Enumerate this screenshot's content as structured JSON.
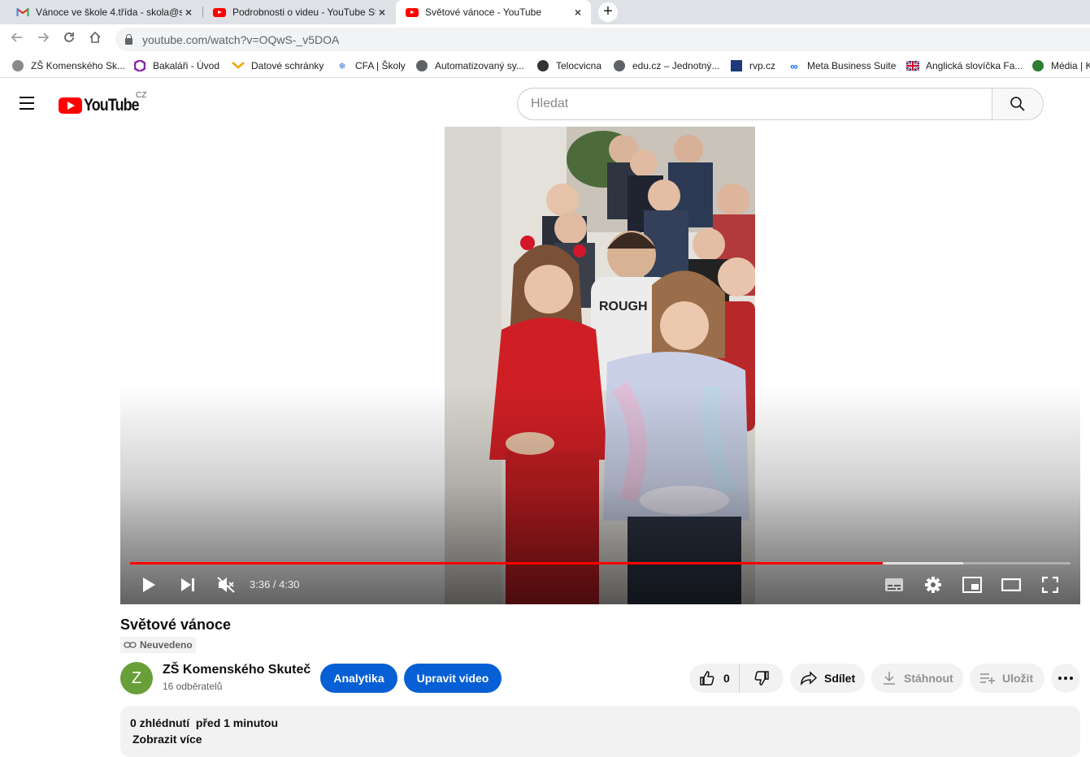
{
  "browser": {
    "tabs": [
      {
        "title": "Vánoce ve škole 4.třída - skola@s",
        "favicon": "gmail-icon"
      },
      {
        "title": "Podrobnosti o videu - YouTube St",
        "favicon": "youtube-icon"
      },
      {
        "title": "Světové vánoce - YouTube",
        "favicon": "youtube-icon",
        "active": true
      }
    ],
    "new_tab_label": "+",
    "close_glyph": "×",
    "url": "youtube.com/watch?v=OQwS-_v5DOA",
    "bookmarks": [
      "ZŠ Komenského Sk...",
      "Bakaláři - Úvod",
      "Datové schránky",
      "CFA | Školy",
      "Automatizovaný sy...",
      "Telocvicna",
      "edu.cz – Jednotný...",
      "rvp.cz",
      "Meta Business Suite",
      "Anglická slovíčka Fa...",
      "Média | K"
    ]
  },
  "youtube": {
    "logo_text": "YouTube",
    "country_code": "CZ",
    "search_placeholder": "Hledat",
    "player": {
      "time_current": "3:36",
      "time_separator": " / ",
      "time_total": "4:30",
      "played_fraction": 0.8,
      "buffered_fraction": 0.886
    },
    "video": {
      "title": "Světové vánoce",
      "visibility": "Neuvedeno",
      "channel_initial": "Z",
      "channel_name": "ZŠ Komenského Skuteč",
      "subscribers": "16 odběratelů",
      "analytics_label": "Analytika",
      "edit_label": "Upravit video",
      "likes": "0",
      "share_label": "Sdílet",
      "download_label": "Stáhnout",
      "save_label": "Uložit",
      "views": "0 zhlédnutí",
      "published": "před 1 minutou",
      "show_more": "Zobrazit více"
    }
  },
  "colors": {
    "accent_red": "#ff0000",
    "button_blue": "#065fd4",
    "avatar_green": "#689f38"
  }
}
